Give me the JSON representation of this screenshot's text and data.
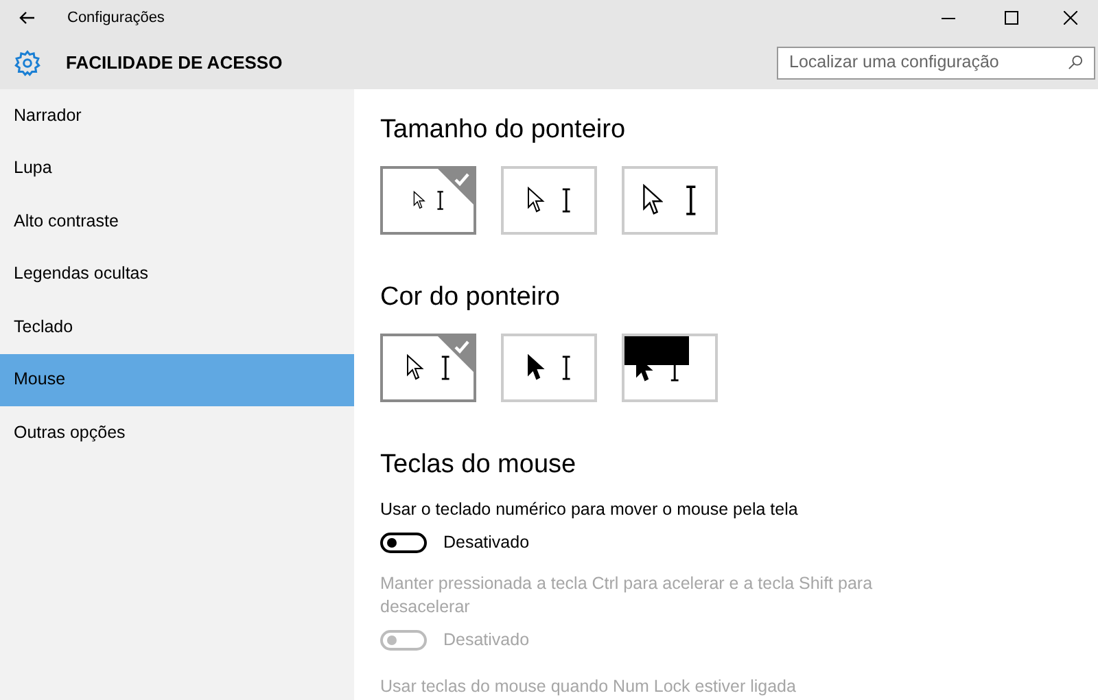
{
  "window": {
    "title": "Configurações"
  },
  "header": {
    "title": "FACILIDADE DE ACESSO",
    "search": {
      "placeholder": "Localizar uma configuração"
    }
  },
  "sidebar": {
    "items": [
      {
        "label": "Narrador",
        "selected": false
      },
      {
        "label": "Lupa",
        "selected": false
      },
      {
        "label": "Alto contraste",
        "selected": false
      },
      {
        "label": "Legendas ocultas",
        "selected": false
      },
      {
        "label": "Teclado",
        "selected": false
      },
      {
        "label": "Mouse",
        "selected": true
      },
      {
        "label": "Outras opções",
        "selected": false
      }
    ]
  },
  "pointer_size": {
    "title": "Tamanho do ponteiro",
    "options": [
      {
        "kind": "small",
        "selected": true
      },
      {
        "kind": "medium",
        "selected": false
      },
      {
        "kind": "large",
        "selected": false
      }
    ]
  },
  "pointer_color": {
    "title": "Cor do ponteiro",
    "options": [
      {
        "kind": "white",
        "selected": true
      },
      {
        "kind": "black",
        "selected": false
      },
      {
        "kind": "inverted",
        "selected": false
      }
    ]
  },
  "mouse_keys": {
    "title": "Teclas do mouse",
    "settings": [
      {
        "label": "Usar o teclado numérico para mover o mouse pela tela",
        "state_text": "Desativado",
        "on": false,
        "disabled": false
      },
      {
        "label": "Manter pressionada a tecla Ctrl para acelerar e a tecla Shift para desacelerar",
        "state_text": "Desativado",
        "on": false,
        "disabled": true
      }
    ],
    "cut_label": "Usar teclas do mouse quando Num Lock estiver ligada"
  }
}
